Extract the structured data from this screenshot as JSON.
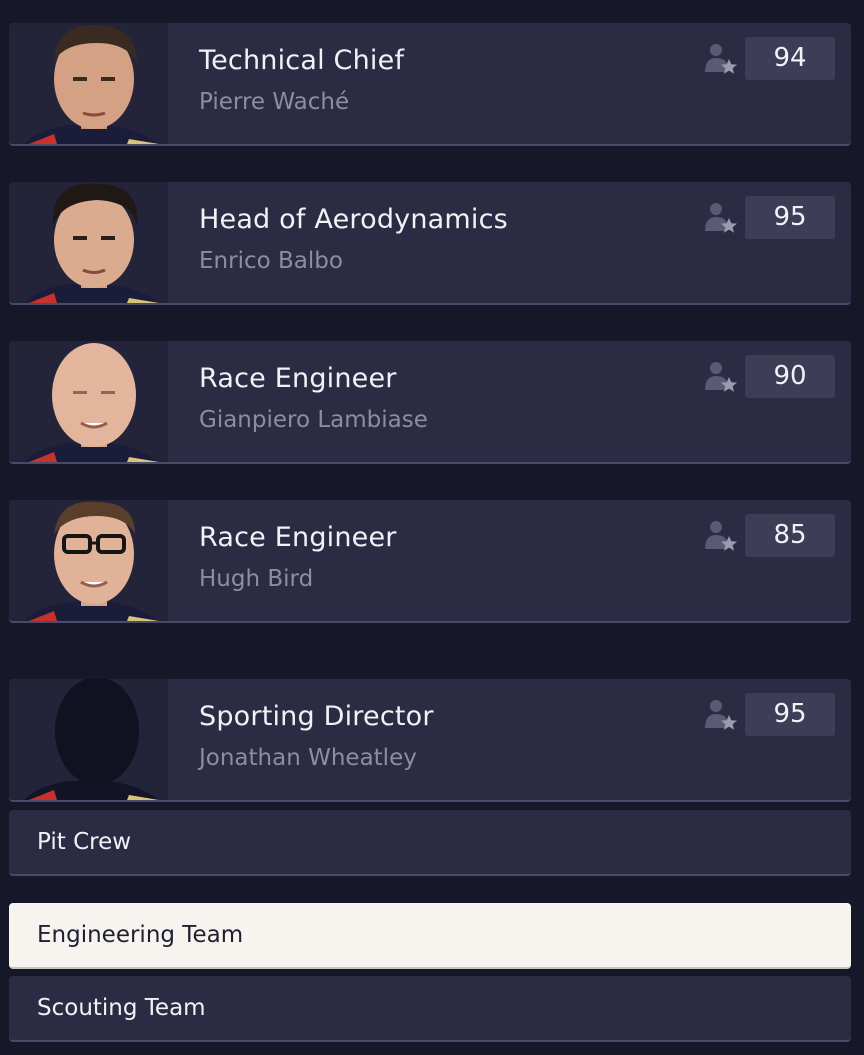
{
  "staff": [
    {
      "role": "Technical Chief",
      "name": "Pierre Waché",
      "rating": "94",
      "portrait": "photo"
    },
    {
      "role": "Head of Aerodynamics",
      "name": "Enrico Balbo",
      "rating": "95",
      "portrait": "photo"
    },
    {
      "role": "Race Engineer",
      "name": "Gianpiero Lambiase",
      "rating": "90",
      "portrait": "photo"
    },
    {
      "role": "Race Engineer",
      "name": "Hugh Bird",
      "rating": "85",
      "portrait": "photo"
    },
    {
      "role": "Sporting Director",
      "name": "Jonathan Wheatley",
      "rating": "95",
      "portrait": "silhouette"
    }
  ],
  "rating_icon": "person-star-icon",
  "tabs": [
    {
      "label": "Pit Crew",
      "active": false
    },
    {
      "label": "Engineering Team",
      "active": true
    },
    {
      "label": "Scouting Team",
      "active": false
    }
  ],
  "colors": {
    "background": "#17172a",
    "card": "#2b2b44",
    "rating_box": "#3d3d57",
    "active_tab": "#f7f3ee"
  }
}
